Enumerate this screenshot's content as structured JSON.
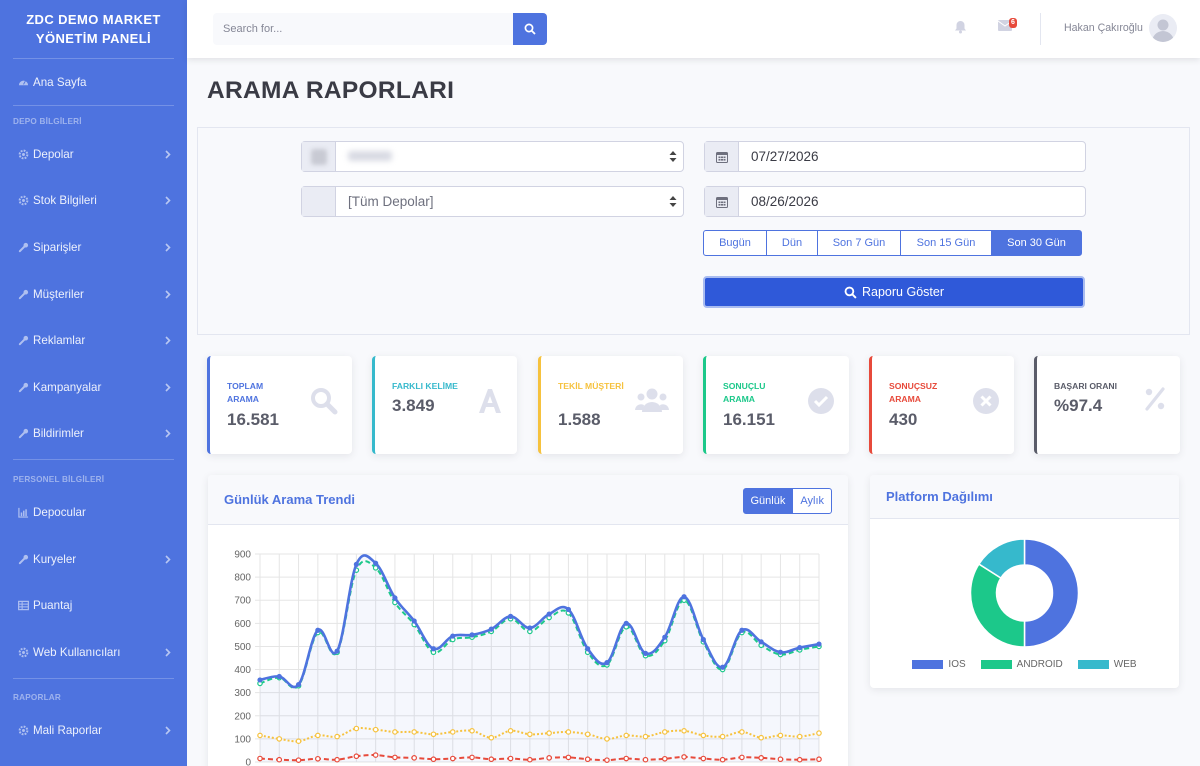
{
  "sidebar": {
    "brand": "ZDC DEMO MARKET YÖNETİM PANELİ",
    "home": "Ana Sayfa",
    "section1": "DEPO BİLGİLERİ",
    "items1": [
      "Depolar",
      "Stok Bilgileri",
      "Siparişler",
      "Müşteriler",
      "Reklamlar",
      "Kampanyalar",
      "Bildirimler"
    ],
    "section2": "PERSONEL BİLGİLERİ",
    "items2": [
      "Depocular",
      "Kuryeler",
      "Puantaj",
      "Web Kullanıcıları"
    ],
    "section3": "RAPORLAR",
    "items3": [
      "Mali Raporlar"
    ]
  },
  "topbar": {
    "search_placeholder": "Search for...",
    "messages_count": "6",
    "username": "Hakan Çakıroğlu"
  },
  "page": {
    "title": "ARAMA RAPORLARI"
  },
  "filters": {
    "store_value": "",
    "depot_value": "[Tüm Depolar]",
    "start_date": "07/27/2026",
    "end_date": "08/26/2026",
    "ranges": [
      "Bugün",
      "Dün",
      "Son 7 Gün",
      "Son 15 Gün",
      "Son 30 Gün"
    ],
    "active_range": "Son 30 Gün",
    "submit": "Raporu Göster"
  },
  "kpis": [
    {
      "label": "TOPLAM ARAMA",
      "value": "16.581",
      "color": "#4e73df",
      "icon": "search-icon"
    },
    {
      "label": "FARKLI KELİME",
      "value": "3.849",
      "color": "#36b9cc",
      "icon": "font-icon"
    },
    {
      "label": "TEKİL MÜŞTERİ",
      "value": "1.588",
      "color": "#f6c23e",
      "icon": "users-icon"
    },
    {
      "label": "SONUÇLU ARAMA",
      "value": "16.151",
      "color": "#1cc88a",
      "icon": "check-circle-icon"
    },
    {
      "label": "SONUÇSUZ ARAMA",
      "value": "430",
      "color": "#e74a3b",
      "icon": "times-circle-icon"
    },
    {
      "label": "BAŞARI ORANI",
      "value": "%97.4",
      "color": "#5a5c69",
      "icon": "percent-icon"
    }
  ],
  "trend": {
    "title": "Günlük Arama Trendi",
    "toggle": [
      "Günlük",
      "Aylık"
    ],
    "active_toggle": "Günlük"
  },
  "platform": {
    "title": "Platform Dağılımı"
  },
  "chart_data": [
    {
      "type": "line",
      "title": "Günlük Arama Trendi",
      "ylim": [
        0,
        900
      ],
      "yticks": [
        0,
        100,
        200,
        300,
        400,
        500,
        600,
        700,
        800,
        900
      ],
      "grid": true,
      "series": [
        {
          "color": "#4e73df",
          "style": "solid",
          "values": [
            355,
            370,
            335,
            570,
            480,
            855,
            860,
            710,
            610,
            490,
            545,
            550,
            575,
            630,
            580,
            640,
            660,
            490,
            430,
            600,
            470,
            540,
            715,
            530,
            410,
            570,
            520,
            475,
            495,
            510
          ]
        },
        {
          "color": "#1cc88a",
          "style": "dashed",
          "values": [
            340,
            365,
            330,
            560,
            475,
            830,
            840,
            690,
            595,
            475,
            530,
            540,
            565,
            620,
            565,
            625,
            645,
            475,
            420,
            585,
            460,
            525,
            700,
            520,
            400,
            560,
            505,
            465,
            485,
            500
          ]
        },
        {
          "color": "#f6c23e",
          "style": "dotted",
          "values": [
            115,
            100,
            90,
            115,
            110,
            145,
            140,
            130,
            130,
            120,
            130,
            135,
            105,
            135,
            120,
            125,
            130,
            120,
            100,
            115,
            110,
            130,
            135,
            115,
            110,
            130,
            105,
            115,
            110,
            125
          ]
        },
        {
          "color": "#e74a3b",
          "style": "dashed",
          "values": [
            15,
            10,
            8,
            14,
            10,
            25,
            30,
            20,
            18,
            12,
            15,
            20,
            12,
            15,
            10,
            18,
            20,
            12,
            8,
            15,
            10,
            14,
            22,
            15,
            10,
            20,
            18,
            12,
            10,
            12
          ]
        }
      ]
    },
    {
      "type": "pie",
      "title": "Platform Dağılımı",
      "categories": [
        "IOS",
        "ANDROID",
        "WEB"
      ],
      "values": [
        50,
        34,
        16
      ],
      "colors": [
        "#4e73df",
        "#1cc88a",
        "#36b9cc"
      ],
      "legend": "bottom"
    }
  ]
}
